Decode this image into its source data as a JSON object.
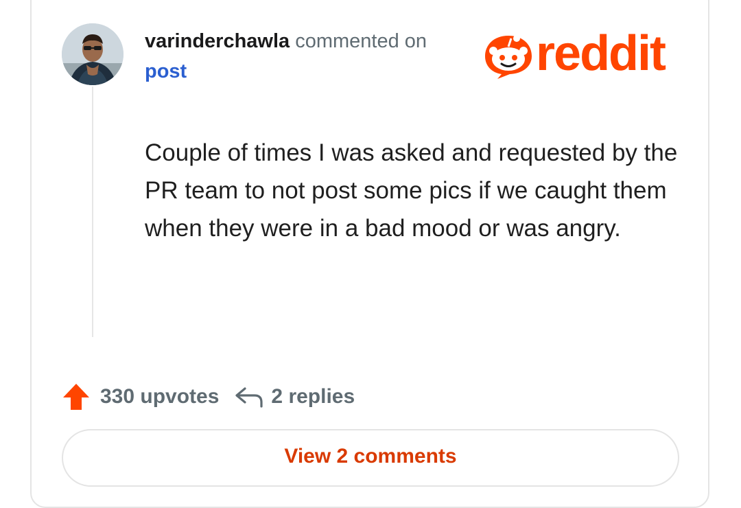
{
  "comment": {
    "username": "varinderchawla",
    "action_text": "commented on",
    "post_link": "post",
    "body": "Couple of times I was asked and requested by the PR team to not post some pics if we caught them when they were in a bad mood or was angry."
  },
  "brand": {
    "logo_text": "reddit",
    "accent_color": "#ff4500"
  },
  "stats": {
    "upvotes": "330 upvotes",
    "replies": "2 replies"
  },
  "footer": {
    "view_comments_label": "View 2 comments"
  },
  "icons": {
    "upvote": "arrow-up-icon",
    "reply": "reply-arrow-icon",
    "avatar": "user-avatar",
    "logo": "reddit-snoo-icon"
  }
}
